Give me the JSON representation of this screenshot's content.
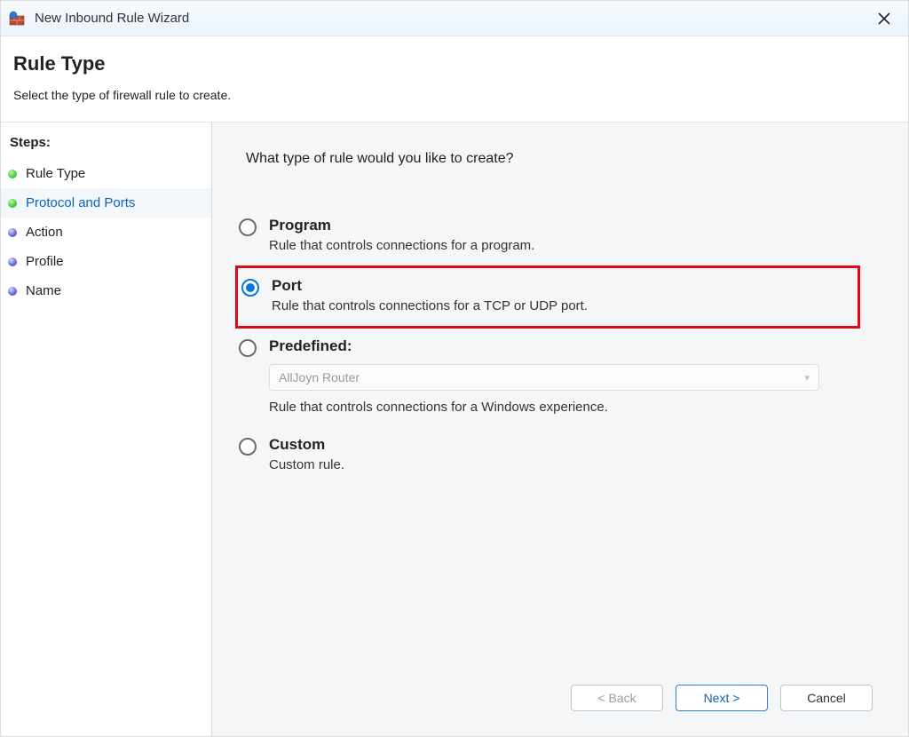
{
  "titlebar": {
    "title": "New Inbound Rule Wizard"
  },
  "header": {
    "heading": "Rule Type",
    "subtitle": "Select the type of firewall rule to create."
  },
  "sidebar": {
    "steps_label": "Steps:",
    "items": [
      {
        "label": "Rule Type",
        "bullet": "green",
        "active": false
      },
      {
        "label": "Protocol and Ports",
        "bullet": "green",
        "active": true
      },
      {
        "label": "Action",
        "bullet": "blue",
        "active": false
      },
      {
        "label": "Profile",
        "bullet": "blue",
        "active": false
      },
      {
        "label": "Name",
        "bullet": "blue",
        "active": false
      }
    ]
  },
  "content": {
    "prompt": "What type of rule would you like to create?",
    "options": {
      "program": {
        "label": "Program",
        "desc": "Rule that controls connections for a program."
      },
      "port": {
        "label": "Port",
        "desc": "Rule that controls connections for a TCP or UDP port."
      },
      "predefined": {
        "label": "Predefined:",
        "desc": "Rule that controls connections for a Windows experience.",
        "selected_value": "AllJoyn Router"
      },
      "custom": {
        "label": "Custom",
        "desc": "Custom rule."
      }
    },
    "selected": "port"
  },
  "footer": {
    "back": "< Back",
    "next": "Next >",
    "cancel": "Cancel"
  }
}
